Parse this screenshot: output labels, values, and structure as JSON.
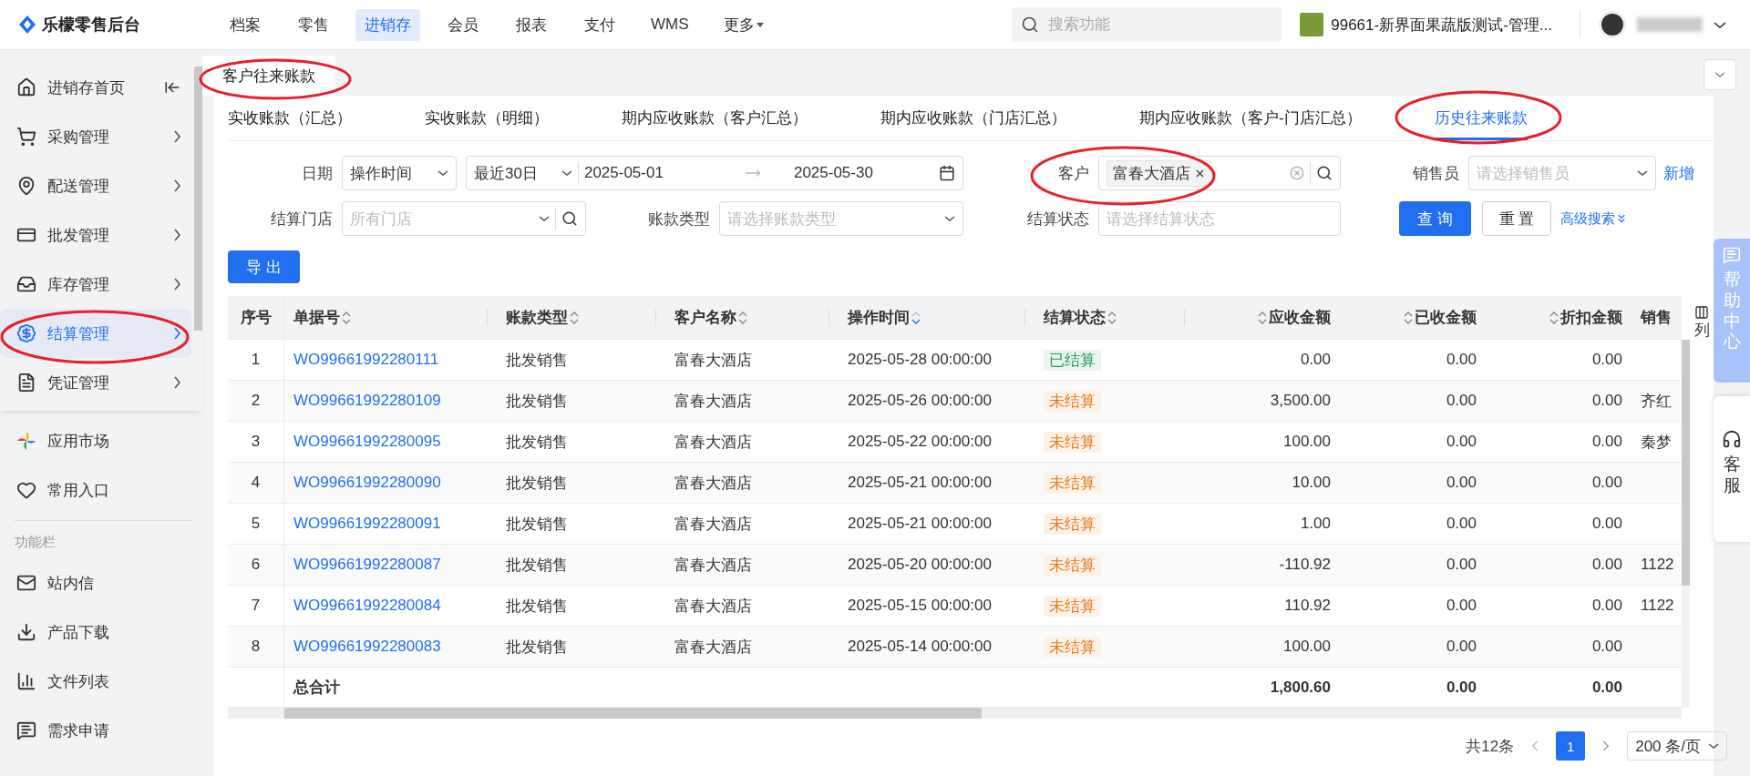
{
  "header": {
    "logo": "乐檬零售后台",
    "nav": [
      {
        "label": "档案",
        "selected": false,
        "kind": "link"
      },
      {
        "label": "零售",
        "selected": false,
        "kind": "link"
      },
      {
        "label": "进销存",
        "selected": true,
        "kind": "link"
      },
      {
        "label": "会员",
        "selected": false,
        "kind": "link"
      },
      {
        "label": "报表",
        "selected": false,
        "kind": "link"
      },
      {
        "label": "支付",
        "selected": false,
        "kind": "link"
      },
      {
        "label": "WMS",
        "selected": false,
        "kind": "link"
      },
      {
        "label": "更多",
        "selected": false,
        "kind": "dropdown"
      }
    ],
    "search": {
      "placeholder": "搜索功能"
    },
    "store": "99661-新界面果蔬版测试-管理..."
  },
  "sidebar": {
    "items": [
      {
        "label": "进销存首页",
        "selected": false,
        "kind": "collapse"
      },
      {
        "label": "采购管理",
        "selected": false,
        "kind": "submenu"
      },
      {
        "label": "配送管理",
        "selected": false,
        "kind": "submenu"
      },
      {
        "label": "批发管理",
        "selected": false,
        "kind": "submenu"
      },
      {
        "label": "库存管理",
        "selected": false,
        "kind": "submenu"
      },
      {
        "label": "结算管理",
        "selected": true,
        "kind": "submenu"
      },
      {
        "label": "凭证管理",
        "selected": false,
        "kind": "submenu"
      }
    ],
    "shortcuts": [
      {
        "label": "应用市场"
      },
      {
        "label": "常用入口"
      }
    ],
    "section_label": "功能栏",
    "tools": [
      {
        "label": "站内信"
      },
      {
        "label": "产品下载"
      },
      {
        "label": "文件列表"
      },
      {
        "label": "需求申请"
      }
    ]
  },
  "page_tab": "客户往来账款",
  "sub_tabs": [
    {
      "label": "实收账款（汇总）",
      "selected": false
    },
    {
      "label": "实收账款（明细）",
      "selected": false
    },
    {
      "label": "期内应收账款（客户汇总）",
      "selected": false
    },
    {
      "label": "期内应收账款（门店汇总）",
      "selected": false
    },
    {
      "label": "期内应收账款（客户-门店汇总）",
      "selected": false
    },
    {
      "label": "历史往来账款",
      "selected": true
    }
  ],
  "filters": {
    "date": {
      "label": "日期",
      "type": "操作时间",
      "range": "最近30日",
      "start": "2025-05-01",
      "end": "2025-05-30"
    },
    "customer": {
      "label": "客户",
      "tags": [
        "富春大酒店"
      ]
    },
    "salesperson": {
      "label": "销售员",
      "placeholder": "请选择销售员",
      "add": "新增"
    },
    "store": {
      "label": "结算门店",
      "placeholder": "所有门店"
    },
    "account_type": {
      "label": "账款类型",
      "placeholder": "请选择账款类型"
    },
    "settle_status": {
      "label": "结算状态",
      "placeholder": "请选择结算状态"
    },
    "query": "查 询",
    "reset": "重 置",
    "advanced": "高级搜索"
  },
  "export": "导 出",
  "table": {
    "columns": [
      {
        "label": "序号",
        "kind": "index"
      },
      {
        "label": "单据号",
        "kind": "text",
        "sorted": false
      },
      {
        "label": "账款类型",
        "kind": "text",
        "sorted": false
      },
      {
        "label": "客户名称",
        "kind": "text",
        "sorted": false
      },
      {
        "label": "操作时间",
        "kind": "text",
        "sorted": true
      },
      {
        "label": "结算状态",
        "kind": "text",
        "sorted": false
      },
      {
        "label": "应收金额",
        "kind": "amount",
        "sorted": false
      },
      {
        "label": "已收金额",
        "kind": "amount",
        "sorted": false
      },
      {
        "label": "折扣金额",
        "kind": "amount",
        "sorted": false
      },
      {
        "label": "销售",
        "kind": "text"
      }
    ],
    "rows": [
      {
        "index": "1",
        "doc_no": "WO99661992280111",
        "type": "批发销售",
        "customer": "富春大酒店",
        "time": "2025-05-28 00:00:00",
        "status": "已结算",
        "settled": true,
        "receivable": "0.00",
        "received": "0.00",
        "discount": "0.00"
      },
      {
        "index": "2",
        "doc_no": "WO99661992280109",
        "type": "批发销售",
        "customer": "富春大酒店",
        "time": "2025-05-26 00:00:00",
        "status": "未结算",
        "settled": false,
        "receivable": "3,500.00",
        "received": "0.00",
        "discount": "0.00",
        "salesperson": "齐红"
      },
      {
        "index": "3",
        "doc_no": "WO99661992280095",
        "type": "批发销售",
        "customer": "富春大酒店",
        "time": "2025-05-22 00:00:00",
        "status": "未结算",
        "settled": false,
        "receivable": "100.00",
        "received": "0.00",
        "discount": "0.00",
        "salesperson": "秦梦"
      },
      {
        "index": "4",
        "doc_no": "WO99661992280090",
        "type": "批发销售",
        "customer": "富春大酒店",
        "time": "2025-05-21 00:00:00",
        "status": "未结算",
        "settled": false,
        "receivable": "10.00",
        "received": "0.00",
        "discount": "0.00"
      },
      {
        "index": "5",
        "doc_no": "WO99661992280091",
        "type": "批发销售",
        "customer": "富春大酒店",
        "time": "2025-05-21 00:00:00",
        "status": "未结算",
        "settled": false,
        "receivable": "1.00",
        "received": "0.00",
        "discount": "0.00"
      },
      {
        "index": "6",
        "doc_no": "WO99661992280087",
        "type": "批发销售",
        "customer": "富春大酒店",
        "time": "2025-05-20 00:00:00",
        "status": "未结算",
        "settled": false,
        "receivable": "-110.92",
        "received": "0.00",
        "discount": "0.00",
        "salesperson": "1122"
      },
      {
        "index": "7",
        "doc_no": "WO99661992280084",
        "type": "批发销售",
        "customer": "富春大酒店",
        "time": "2025-05-15 00:00:00",
        "status": "未结算",
        "settled": false,
        "receivable": "110.92",
        "received": "0.00",
        "discount": "0.00",
        "salesperson": "1122"
      },
      {
        "index": "8",
        "doc_no": "WO99661992280083",
        "type": "批发销售",
        "customer": "富春大酒店",
        "time": "2025-05-14 00:00:00",
        "status": "未结算",
        "settled": false,
        "receivable": "100.00",
        "received": "0.00",
        "discount": "0.00"
      }
    ],
    "totals": {
      "label": "总合计",
      "receivable": "1,800.60",
      "received": "0.00",
      "discount": "0.00"
    },
    "column_setting": "列"
  },
  "pagination": {
    "total": "共12条",
    "pages": [
      {
        "label": "1",
        "selected": true
      }
    ],
    "page_size": "200 条/页"
  },
  "float": {
    "help": "帮助中心",
    "service": "客服"
  }
}
